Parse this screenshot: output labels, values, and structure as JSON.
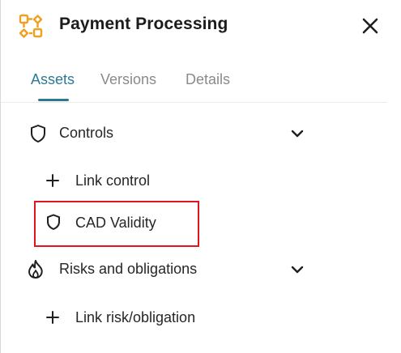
{
  "header": {
    "title": "Payment Processing",
    "icon": "workflow-nodes-icon",
    "close_icon": "close-icon"
  },
  "tabs": [
    {
      "label": "Assets",
      "active": true
    },
    {
      "label": "Versions",
      "active": false
    },
    {
      "label": "Details",
      "active": false
    }
  ],
  "sections": {
    "controls": {
      "label": "Controls",
      "icon": "shield-icon",
      "expanded": true,
      "link_label": "Link control",
      "items": [
        {
          "label": "CAD Validity",
          "icon": "shield-icon",
          "highlighted": true
        }
      ]
    },
    "risks": {
      "label": "Risks and obligations",
      "icon": "flame-icon",
      "expanded": true,
      "link_label": "Link risk/obligation"
    }
  },
  "colors": {
    "accent": "#2b7a93",
    "brand_icon": "#f0a020",
    "highlight_border": "#e0151d",
    "inactive_tab": "#8a8a8a"
  }
}
